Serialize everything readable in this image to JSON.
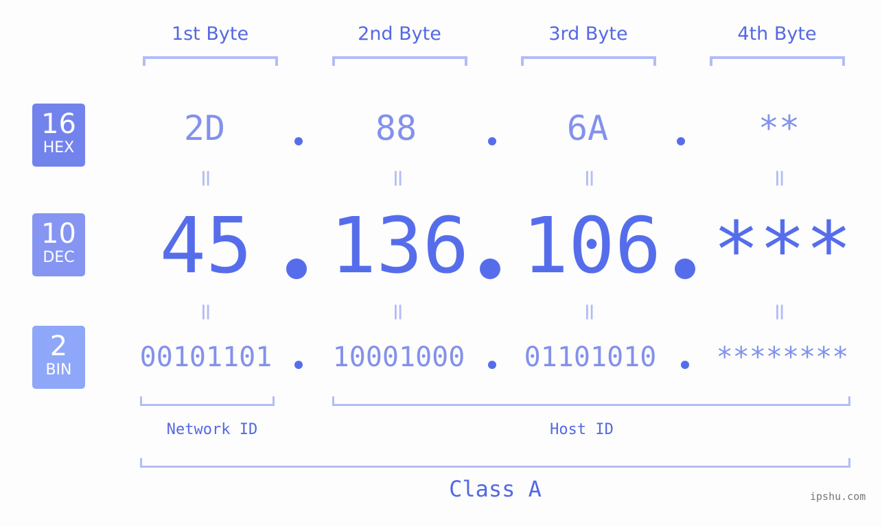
{
  "ip": {
    "decimal": "45.136.106.***",
    "hex": "2D.88.6A.**",
    "binary": "00101101.10001000.01101010.********"
  },
  "badges": [
    {
      "number": "16",
      "label": "HEX",
      "color": "#7383ec"
    },
    {
      "number": "10",
      "label": "DEC",
      "color": "#8595f1"
    },
    {
      "number": "2",
      "label": "BIN",
      "color": "#8fa7f8"
    }
  ],
  "bytes": [
    {
      "header": "1st Byte",
      "hex": "2D",
      "dec": "45",
      "bin": "00101101"
    },
    {
      "header": "2nd Byte",
      "hex": "88",
      "dec": "136",
      "bin": "10001000"
    },
    {
      "header": "3rd Byte",
      "hex": "6A",
      "dec": "106",
      "bin": "01101010"
    },
    {
      "header": "4th Byte",
      "hex": "**",
      "dec": "***",
      "bin": "********"
    }
  ],
  "equals_sign": "=",
  "segments": {
    "network_id": "Network ID",
    "host_id": "Host ID",
    "class": "Class A"
  },
  "watermark": "ipshu.com",
  "colors": {
    "accent": "#566deb",
    "hex_text": "#8391ec",
    "bracket": "#b3bcf7",
    "label": "#5468e4"
  }
}
